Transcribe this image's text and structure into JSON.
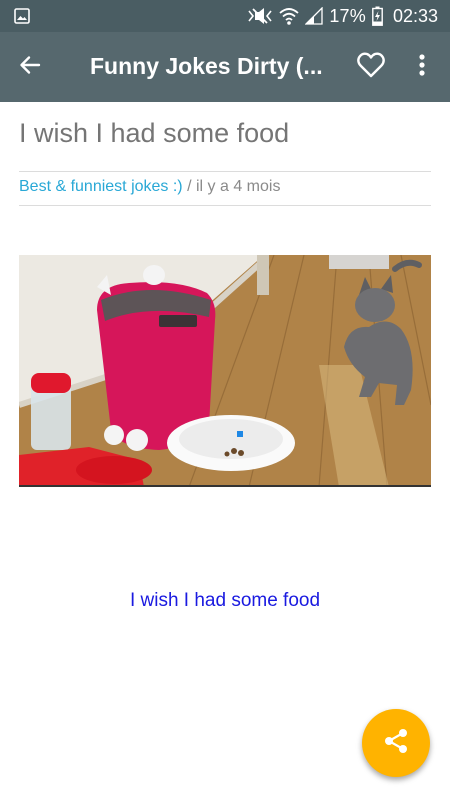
{
  "status_bar": {
    "battery_percent": "17%",
    "time": "02:33",
    "icons": [
      "image-icon",
      "mute-icon",
      "wifi-icon",
      "signal-icon",
      "battery-charging-icon"
    ]
  },
  "toolbar": {
    "title": "Funny Jokes Dirty (...",
    "back_icon": "arrow-back-icon",
    "favorite_icon": "heart-outline-icon",
    "more_icon": "more-vert-icon"
  },
  "post": {
    "title": "I wish I had some food",
    "category": "Best & funniest jokes :)",
    "separator": " / ",
    "time_ago": "il y a 4 mois",
    "caption": "I wish I had some food"
  },
  "fab": {
    "icon": "share-icon",
    "color": "#ffb300"
  },
  "colors": {
    "status_bar": "#4a5d63",
    "toolbar": "#56686e",
    "category_link": "#29a8d6",
    "caption_link": "#1a1ae0"
  }
}
